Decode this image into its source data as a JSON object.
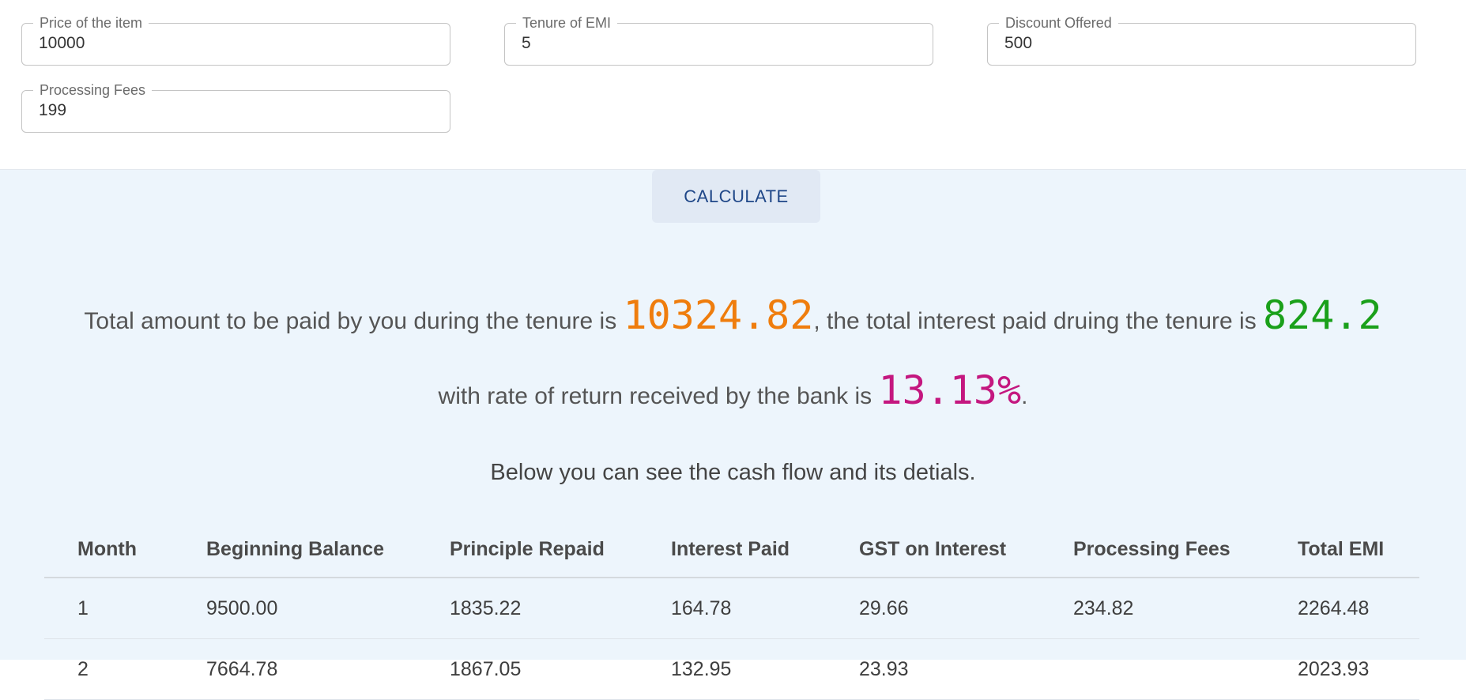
{
  "form": {
    "price": {
      "label": "Price of the item",
      "value": "10000"
    },
    "tenure": {
      "label": "Tenure of EMI",
      "value": "5"
    },
    "discount": {
      "label": "Discount Offered",
      "value": "500"
    },
    "fees": {
      "label": "Processing Fees",
      "value": "199"
    }
  },
  "calculate_label": "CALCULATE",
  "summary": {
    "text_1": "Total amount to be paid by you during the tenure is ",
    "total_amount": "10324.82",
    "text_2": ", the total interest paid druing the tenure is ",
    "total_interest": "824.2",
    "text_3": "with rate of return received by the bank is ",
    "rate": "13.13%",
    "text_4": ".",
    "cash_flow_note": "Below you can see the cash flow and its detials."
  },
  "colors": {
    "amount": "#ef7d0d",
    "interest": "#1aa01a",
    "rate": "#c4177f",
    "button_text": "#1f4788"
  },
  "table": {
    "headers": [
      "Month",
      "Beginning Balance",
      "Principle Repaid",
      "Interest Paid",
      "GST on Interest",
      "Processing Fees",
      "Total EMI"
    ],
    "rows": [
      [
        "1",
        "9500.00",
        "1835.22",
        "164.78",
        "29.66",
        "234.82",
        "2264.48"
      ],
      [
        "2",
        "7664.78",
        "1867.05",
        "132.95",
        "23.93",
        "",
        "2023.93"
      ]
    ]
  }
}
